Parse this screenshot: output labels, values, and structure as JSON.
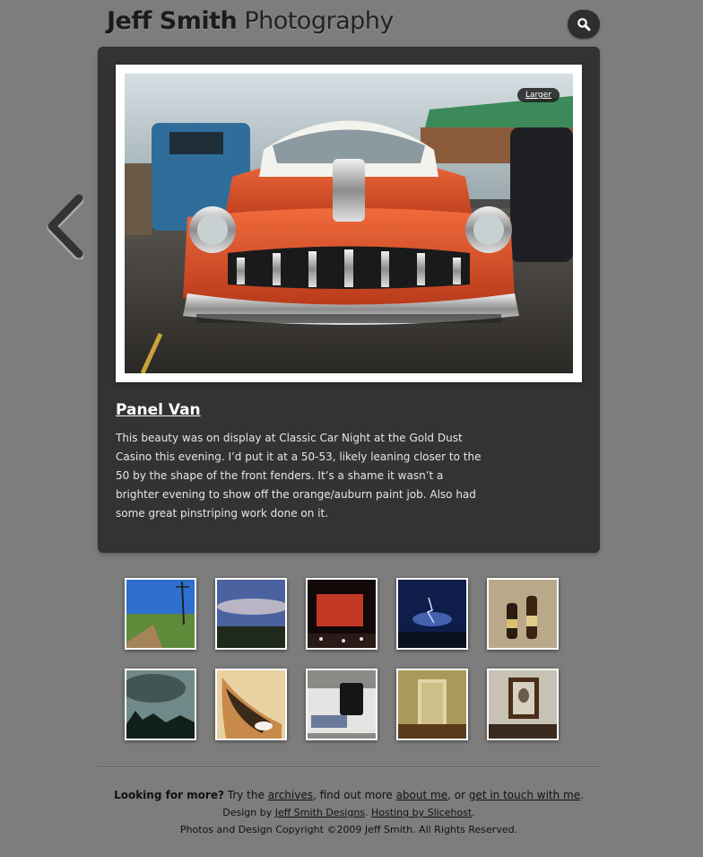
{
  "header": {
    "title_bold": "Jeff Smith",
    "title_rest": "Photography",
    "search_icon": "search-icon"
  },
  "photo": {
    "larger_label": "Larger",
    "title": "Panel Van",
    "description": "This beauty was on display at Classic Car Night at the Gold Dust Casino this evening. I’d put it at a 50-53, likely leaning closer to the 50 by the shape of the front fenders. It’s a shame it wasn’t a brighter evening to show off the orange/auburn paint job. Also had some great pinstriping work done on it."
  },
  "navigation": {
    "prev_icon": "chevron-left-icon"
  },
  "footer": {
    "looking_label": "Looking for more?",
    "try_the": " Try the ",
    "archives_link": "archives",
    "find_out": ", find out more ",
    "about_link": "about me",
    "or": ", or ",
    "contact_link": "get in touch with me",
    "period": ".",
    "design_by": "Design by ",
    "design_link": "Jeff Smith Designs",
    "dot": ". ",
    "hosting_link": "Hosting by Slicehost",
    "period2": ".",
    "copyright": "Photos and Design Copyright ©2009 Jeff Smith. All Rights Reserved."
  },
  "colors": {
    "background": "#7d7d7d",
    "panel": "#333333",
    "car_orange": "#e8552d"
  }
}
